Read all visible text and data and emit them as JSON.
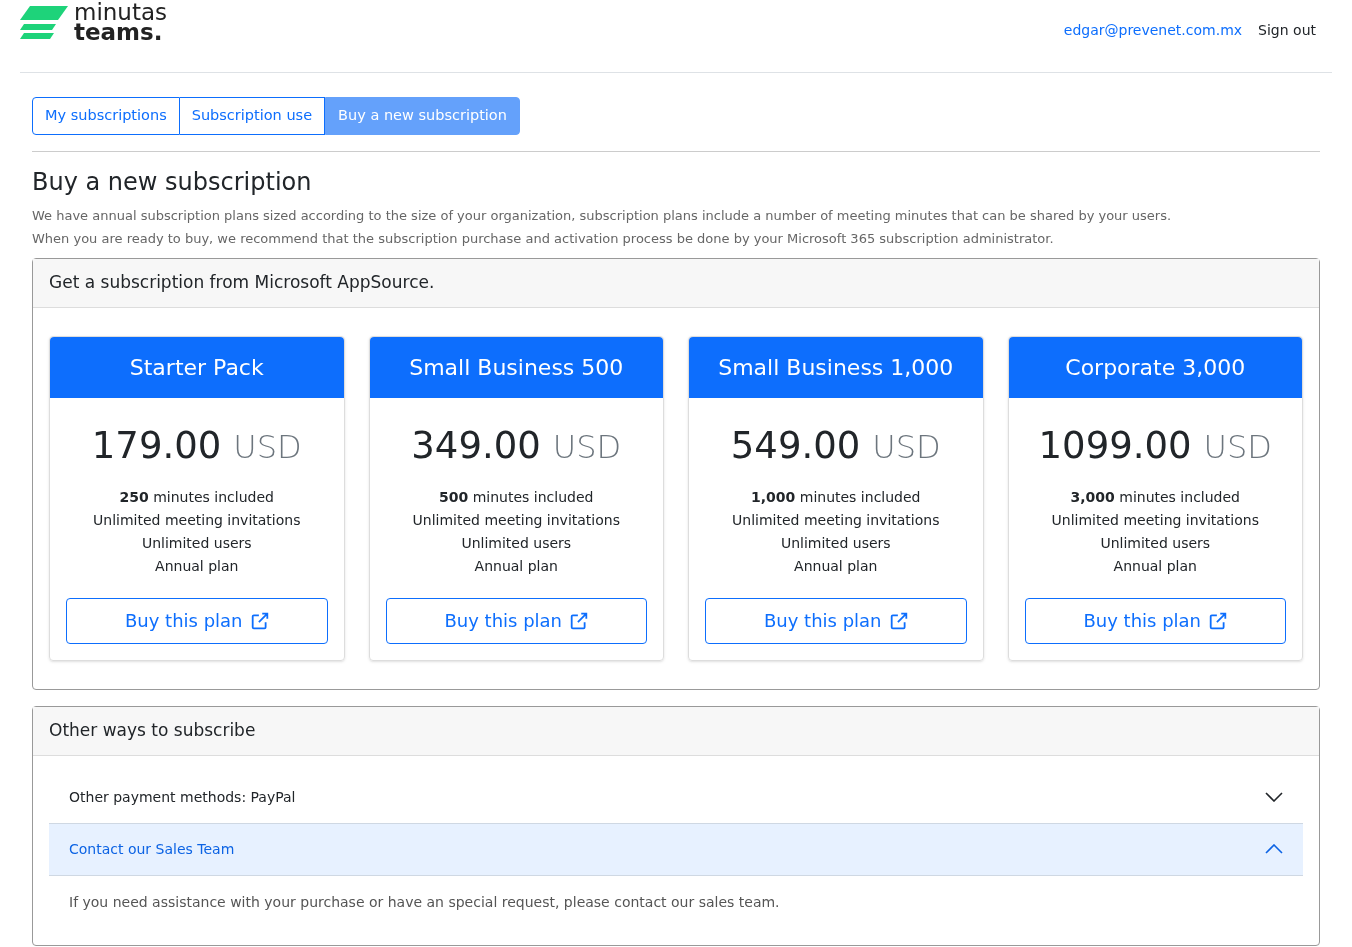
{
  "header": {
    "logo_line_1": "minutas",
    "logo_line_2": "teams.",
    "user_email": "edgar@prevenet.com.mx",
    "sign_out": "Sign out"
  },
  "tabs": [
    {
      "label": "My subscriptions",
      "selected": false
    },
    {
      "label": "Subscription use",
      "selected": false
    },
    {
      "label": "Buy a new subscription",
      "selected": true
    }
  ],
  "title": "Buy a new subscription",
  "description": [
    "We have annual subscription plans sized according to the size of your organization, subscription plans include a number of meeting minutes that can be shared by your users.",
    "When you are ready to buy, we recommend that the subscription purchase and activation process be done by your Microsoft 365 subscription administrator."
  ],
  "appsource": {
    "heading": "Get a subscription from Microsoft AppSource.",
    "plans": [
      {
        "name": "Starter Pack",
        "price": "179.00",
        "currency": "USD",
        "features": [
          "**250** minutes included",
          "Unlimited meeting invitations",
          "Unlimited users",
          "Annual plan"
        ],
        "button": "Buy this plan"
      },
      {
        "name": "Small Business 500",
        "price": "349.00",
        "currency": "USD",
        "features": [
          "**500** minutes included",
          "Unlimited meeting invitations",
          "Unlimited users",
          "Annual plan"
        ],
        "button": "Buy this plan"
      },
      {
        "name": "Small Business 1,000",
        "price": "549.00",
        "currency": "USD",
        "features": [
          "**1,000** minutes included",
          "Unlimited meeting invitations",
          "Unlimited users",
          "Annual plan"
        ],
        "button": "Buy this plan"
      },
      {
        "name": "Corporate 3,000",
        "price": "1099.00",
        "currency": "USD",
        "features": [
          "**3,000** minutes included",
          "Unlimited meeting invitations",
          "Unlimited users",
          "Annual plan"
        ],
        "button": "Buy this plan"
      }
    ]
  },
  "other_ways": {
    "heading": "Other ways to subscribe",
    "items": [
      {
        "title": "Other payment methods: PayPal",
        "expanded": false
      },
      {
        "title": "Contact our Sales Team",
        "expanded": true,
        "body": "If you need assistance with your purchase or have an special request, please contact our sales team."
      }
    ]
  }
}
